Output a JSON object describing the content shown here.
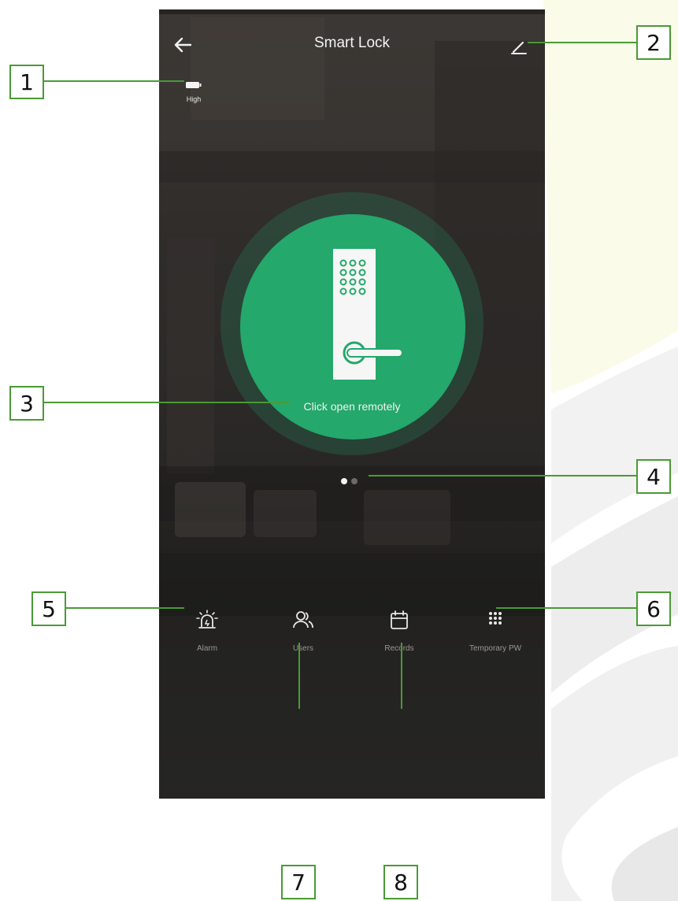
{
  "app": {
    "title": "Smart Lock"
  },
  "header": {
    "back_icon": "arrow-left-icon",
    "edit_icon": "pencil-icon"
  },
  "battery": {
    "icon": "battery-icon",
    "level_label": "High"
  },
  "unlock": {
    "label": "Click open remotely",
    "icon": "door-lock-keypad-icon",
    "accent_color": "#24a86b"
  },
  "pager": {
    "pages": 2,
    "active_index": 0
  },
  "bottom_nav": {
    "items": [
      {
        "label": "Alarm",
        "icon": "alarm-siren-icon"
      },
      {
        "label": "Users",
        "icon": "users-icon"
      },
      {
        "label": "Records",
        "icon": "calendar-icon"
      },
      {
        "label": "Temporary PW",
        "icon": "keypad-icon"
      }
    ]
  },
  "callouts": [
    "1",
    "2",
    "3",
    "4",
    "5",
    "6",
    "7",
    "8"
  ],
  "colors": {
    "callout_border": "#4a9a35",
    "background_swoosh": "#f3f6e2"
  }
}
